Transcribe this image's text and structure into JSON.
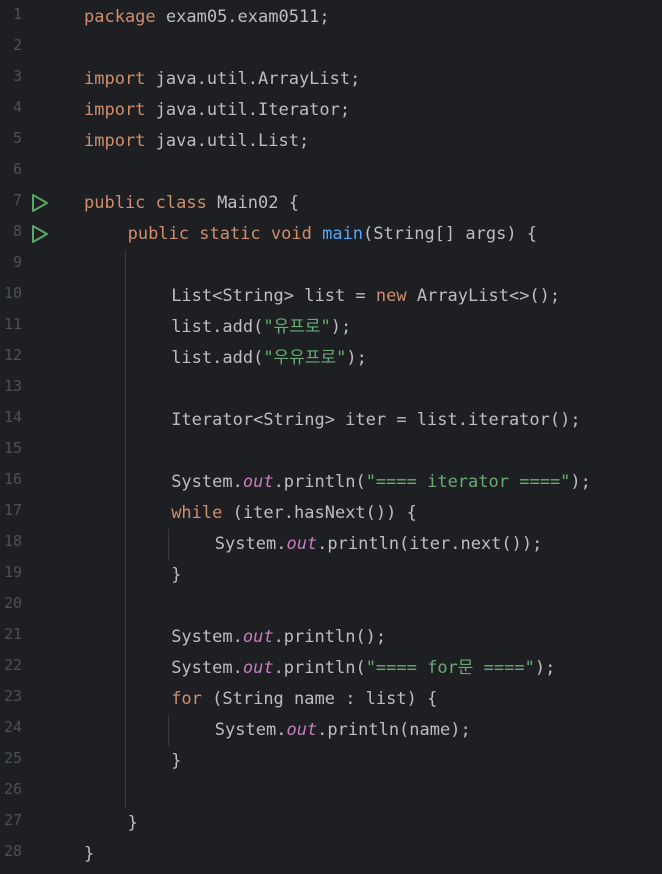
{
  "editor": {
    "language": "java",
    "colors": {
      "background": "#1e1f22",
      "line_number": "#4b5059",
      "plain": "#bcbec4",
      "keyword": "#cf8e6d",
      "method_decl": "#56a8f5",
      "string": "#6aab73",
      "static_field": "#c77dbb",
      "run_icon": "#59a869"
    },
    "run_icon_lines": [
      7,
      8
    ],
    "lines": [
      {
        "n": "1",
        "indent": 0,
        "tokens": [
          [
            "kw",
            "package"
          ],
          [
            "pl",
            " exam05.exam0511;"
          ]
        ]
      },
      {
        "n": "2",
        "indent": 0,
        "tokens": []
      },
      {
        "n": "3",
        "indent": 0,
        "tokens": [
          [
            "kw",
            "import"
          ],
          [
            "pl",
            " java.util.ArrayList;"
          ]
        ]
      },
      {
        "n": "4",
        "indent": 0,
        "tokens": [
          [
            "kw",
            "import"
          ],
          [
            "pl",
            " java.util.Iterator;"
          ]
        ]
      },
      {
        "n": "5",
        "indent": 0,
        "tokens": [
          [
            "kw",
            "import"
          ],
          [
            "pl",
            " java.util.List;"
          ]
        ]
      },
      {
        "n": "6",
        "indent": 0,
        "tokens": []
      },
      {
        "n": "7",
        "indent": 0,
        "tokens": [
          [
            "kw",
            "public class"
          ],
          [
            "pl",
            " Main02 {"
          ]
        ]
      },
      {
        "n": "8",
        "indent": 4,
        "tokens": [
          [
            "kw",
            "public static void"
          ],
          [
            "pl",
            " "
          ],
          [
            "fn",
            "main"
          ],
          [
            "pl",
            "(String[] args) {"
          ]
        ]
      },
      {
        "n": "9",
        "indent": 0,
        "tokens": []
      },
      {
        "n": "10",
        "indent": 8,
        "tokens": [
          [
            "pl",
            "List<String> list = "
          ],
          [
            "kw",
            "new"
          ],
          [
            "pl",
            " ArrayList<>();"
          ]
        ]
      },
      {
        "n": "11",
        "indent": 8,
        "tokens": [
          [
            "pl",
            "list.add("
          ],
          [
            "st",
            "\"유프로\""
          ],
          [
            "pl",
            ");"
          ]
        ]
      },
      {
        "n": "12",
        "indent": 8,
        "tokens": [
          [
            "pl",
            "list.add("
          ],
          [
            "st",
            "\"우유프로\""
          ],
          [
            "pl",
            ");"
          ]
        ]
      },
      {
        "n": "13",
        "indent": 0,
        "tokens": []
      },
      {
        "n": "14",
        "indent": 8,
        "tokens": [
          [
            "pl",
            "Iterator<String> iter = list.iterator();"
          ]
        ]
      },
      {
        "n": "15",
        "indent": 0,
        "tokens": []
      },
      {
        "n": "16",
        "indent": 8,
        "tokens": [
          [
            "pl",
            "System."
          ],
          [
            "fld",
            "out"
          ],
          [
            "pl",
            ".println("
          ],
          [
            "st",
            "\"==== iterator ====\""
          ],
          [
            "pl",
            ");"
          ]
        ]
      },
      {
        "n": "17",
        "indent": 8,
        "tokens": [
          [
            "kw",
            "while"
          ],
          [
            "pl",
            " (iter.hasNext()) {"
          ]
        ]
      },
      {
        "n": "18",
        "indent": 12,
        "tokens": [
          [
            "pl",
            "System."
          ],
          [
            "fld",
            "out"
          ],
          [
            "pl",
            ".println(iter.next());"
          ]
        ]
      },
      {
        "n": "19",
        "indent": 8,
        "tokens": [
          [
            "pl",
            "}"
          ]
        ]
      },
      {
        "n": "20",
        "indent": 0,
        "tokens": []
      },
      {
        "n": "21",
        "indent": 8,
        "tokens": [
          [
            "pl",
            "System."
          ],
          [
            "fld",
            "out"
          ],
          [
            "pl",
            ".println();"
          ]
        ]
      },
      {
        "n": "22",
        "indent": 8,
        "tokens": [
          [
            "pl",
            "System."
          ],
          [
            "fld",
            "out"
          ],
          [
            "pl",
            ".println("
          ],
          [
            "st",
            "\"==== for문 ====\""
          ],
          [
            "pl",
            ");"
          ]
        ]
      },
      {
        "n": "23",
        "indent": 8,
        "tokens": [
          [
            "kw",
            "for"
          ],
          [
            "pl",
            " (String name : list) {"
          ]
        ]
      },
      {
        "n": "24",
        "indent": 12,
        "tokens": [
          [
            "pl",
            "System."
          ],
          [
            "fld",
            "out"
          ],
          [
            "pl",
            ".println(name);"
          ]
        ]
      },
      {
        "n": "25",
        "indent": 8,
        "tokens": [
          [
            "pl",
            "}"
          ]
        ]
      },
      {
        "n": "26",
        "indent": 0,
        "tokens": []
      },
      {
        "n": "27",
        "indent": 4,
        "tokens": [
          [
            "pl",
            "}"
          ]
        ]
      },
      {
        "n": "28",
        "indent": 0,
        "tokens": [
          [
            "pl",
            "}"
          ]
        ]
      }
    ]
  }
}
